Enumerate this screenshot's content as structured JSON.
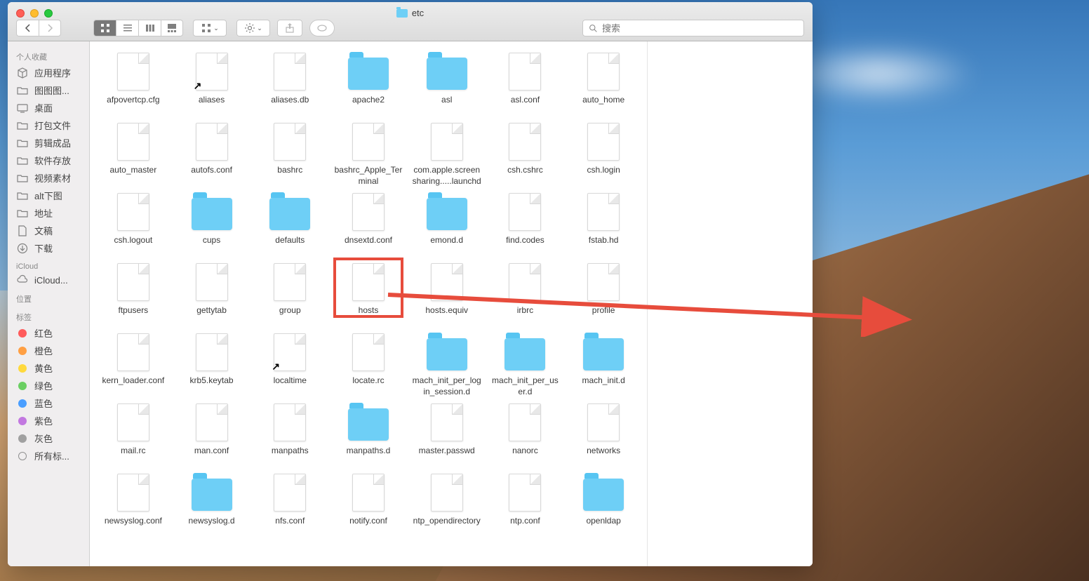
{
  "window": {
    "title": "etc"
  },
  "toolbar": {
    "search_placeholder": "搜索"
  },
  "sidebar": {
    "favorites_header": "个人收藏",
    "favorites": [
      {
        "label": "应用程序",
        "icon": "app"
      },
      {
        "label": "图图图...",
        "icon": "folder"
      },
      {
        "label": "桌面",
        "icon": "desktop"
      },
      {
        "label": "打包文件",
        "icon": "folder"
      },
      {
        "label": "剪辑成品",
        "icon": "folder"
      },
      {
        "label": "软件存放",
        "icon": "folder"
      },
      {
        "label": "视频素材",
        "icon": "folder"
      },
      {
        "label": "alt下图",
        "icon": "folder"
      },
      {
        "label": "地址",
        "icon": "folder"
      },
      {
        "label": "文稿",
        "icon": "doc"
      },
      {
        "label": "下载",
        "icon": "download"
      }
    ],
    "icloud_header": "iCloud",
    "icloud": [
      {
        "label": "iCloud...",
        "icon": "cloud"
      }
    ],
    "locations_header": "位置",
    "tags_header": "标签",
    "tags": [
      {
        "label": "红色",
        "color": "#ff5b5b"
      },
      {
        "label": "橙色",
        "color": "#ff9f43"
      },
      {
        "label": "黄色",
        "color": "#ffd93d"
      },
      {
        "label": "绿色",
        "color": "#6bcf63"
      },
      {
        "label": "蓝色",
        "color": "#4a9eff"
      },
      {
        "label": "紫色",
        "color": "#c278e0"
      },
      {
        "label": "灰色",
        "color": "#a0a0a0"
      }
    ],
    "all_tags": "所有标..."
  },
  "files": [
    {
      "name": "afpovertcp.cfg",
      "type": "file"
    },
    {
      "name": "aliases",
      "type": "file",
      "alias": true
    },
    {
      "name": "aliases.db",
      "type": "file"
    },
    {
      "name": "apache2",
      "type": "folder"
    },
    {
      "name": "asl",
      "type": "folder"
    },
    {
      "name": "asl.conf",
      "type": "file"
    },
    {
      "name": "auto_home",
      "type": "file"
    },
    {
      "name": "auto_master",
      "type": "file"
    },
    {
      "name": "autofs.conf",
      "type": "file"
    },
    {
      "name": "bashrc",
      "type": "file"
    },
    {
      "name": "bashrc_Apple_Terminal",
      "type": "file"
    },
    {
      "name": "com.apple.screensharing.....launchd",
      "type": "file"
    },
    {
      "name": "csh.cshrc",
      "type": "file"
    },
    {
      "name": "csh.login",
      "type": "file"
    },
    {
      "name": "csh.logout",
      "type": "file"
    },
    {
      "name": "cups",
      "type": "folder"
    },
    {
      "name": "defaults",
      "type": "folder"
    },
    {
      "name": "dnsextd.conf",
      "type": "file"
    },
    {
      "name": "emond.d",
      "type": "folder"
    },
    {
      "name": "find.codes",
      "type": "file"
    },
    {
      "name": "fstab.hd",
      "type": "file"
    },
    {
      "name": "ftpusers",
      "type": "file"
    },
    {
      "name": "gettytab",
      "type": "file"
    },
    {
      "name": "group",
      "type": "file"
    },
    {
      "name": "hosts",
      "type": "file",
      "highlighted": true
    },
    {
      "name": "hosts.equiv",
      "type": "file"
    },
    {
      "name": "irbrc",
      "type": "file"
    },
    {
      "name": "profile",
      "type": "file"
    },
    {
      "name": "kern_loader.conf",
      "type": "file"
    },
    {
      "name": "krb5.keytab",
      "type": "file"
    },
    {
      "name": "localtime",
      "type": "file",
      "alias": true
    },
    {
      "name": "locate.rc",
      "type": "file"
    },
    {
      "name": "mach_init_per_login_session.d",
      "type": "folder"
    },
    {
      "name": "mach_init_per_user.d",
      "type": "folder"
    },
    {
      "name": "mach_init.d",
      "type": "folder"
    },
    {
      "name": "mail.rc",
      "type": "file"
    },
    {
      "name": "man.conf",
      "type": "file"
    },
    {
      "name": "manpaths",
      "type": "file"
    },
    {
      "name": "manpaths.d",
      "type": "folder"
    },
    {
      "name": "master.passwd",
      "type": "file"
    },
    {
      "name": "nanorc",
      "type": "file"
    },
    {
      "name": "networks",
      "type": "file"
    },
    {
      "name": "newsyslog.conf",
      "type": "file"
    },
    {
      "name": "newsyslog.d",
      "type": "folder"
    },
    {
      "name": "nfs.conf",
      "type": "file"
    },
    {
      "name": "notify.conf",
      "type": "file"
    },
    {
      "name": "ntp_opendirectory",
      "type": "file"
    },
    {
      "name": "ntp.conf",
      "type": "file"
    },
    {
      "name": "openldap",
      "type": "folder"
    }
  ]
}
